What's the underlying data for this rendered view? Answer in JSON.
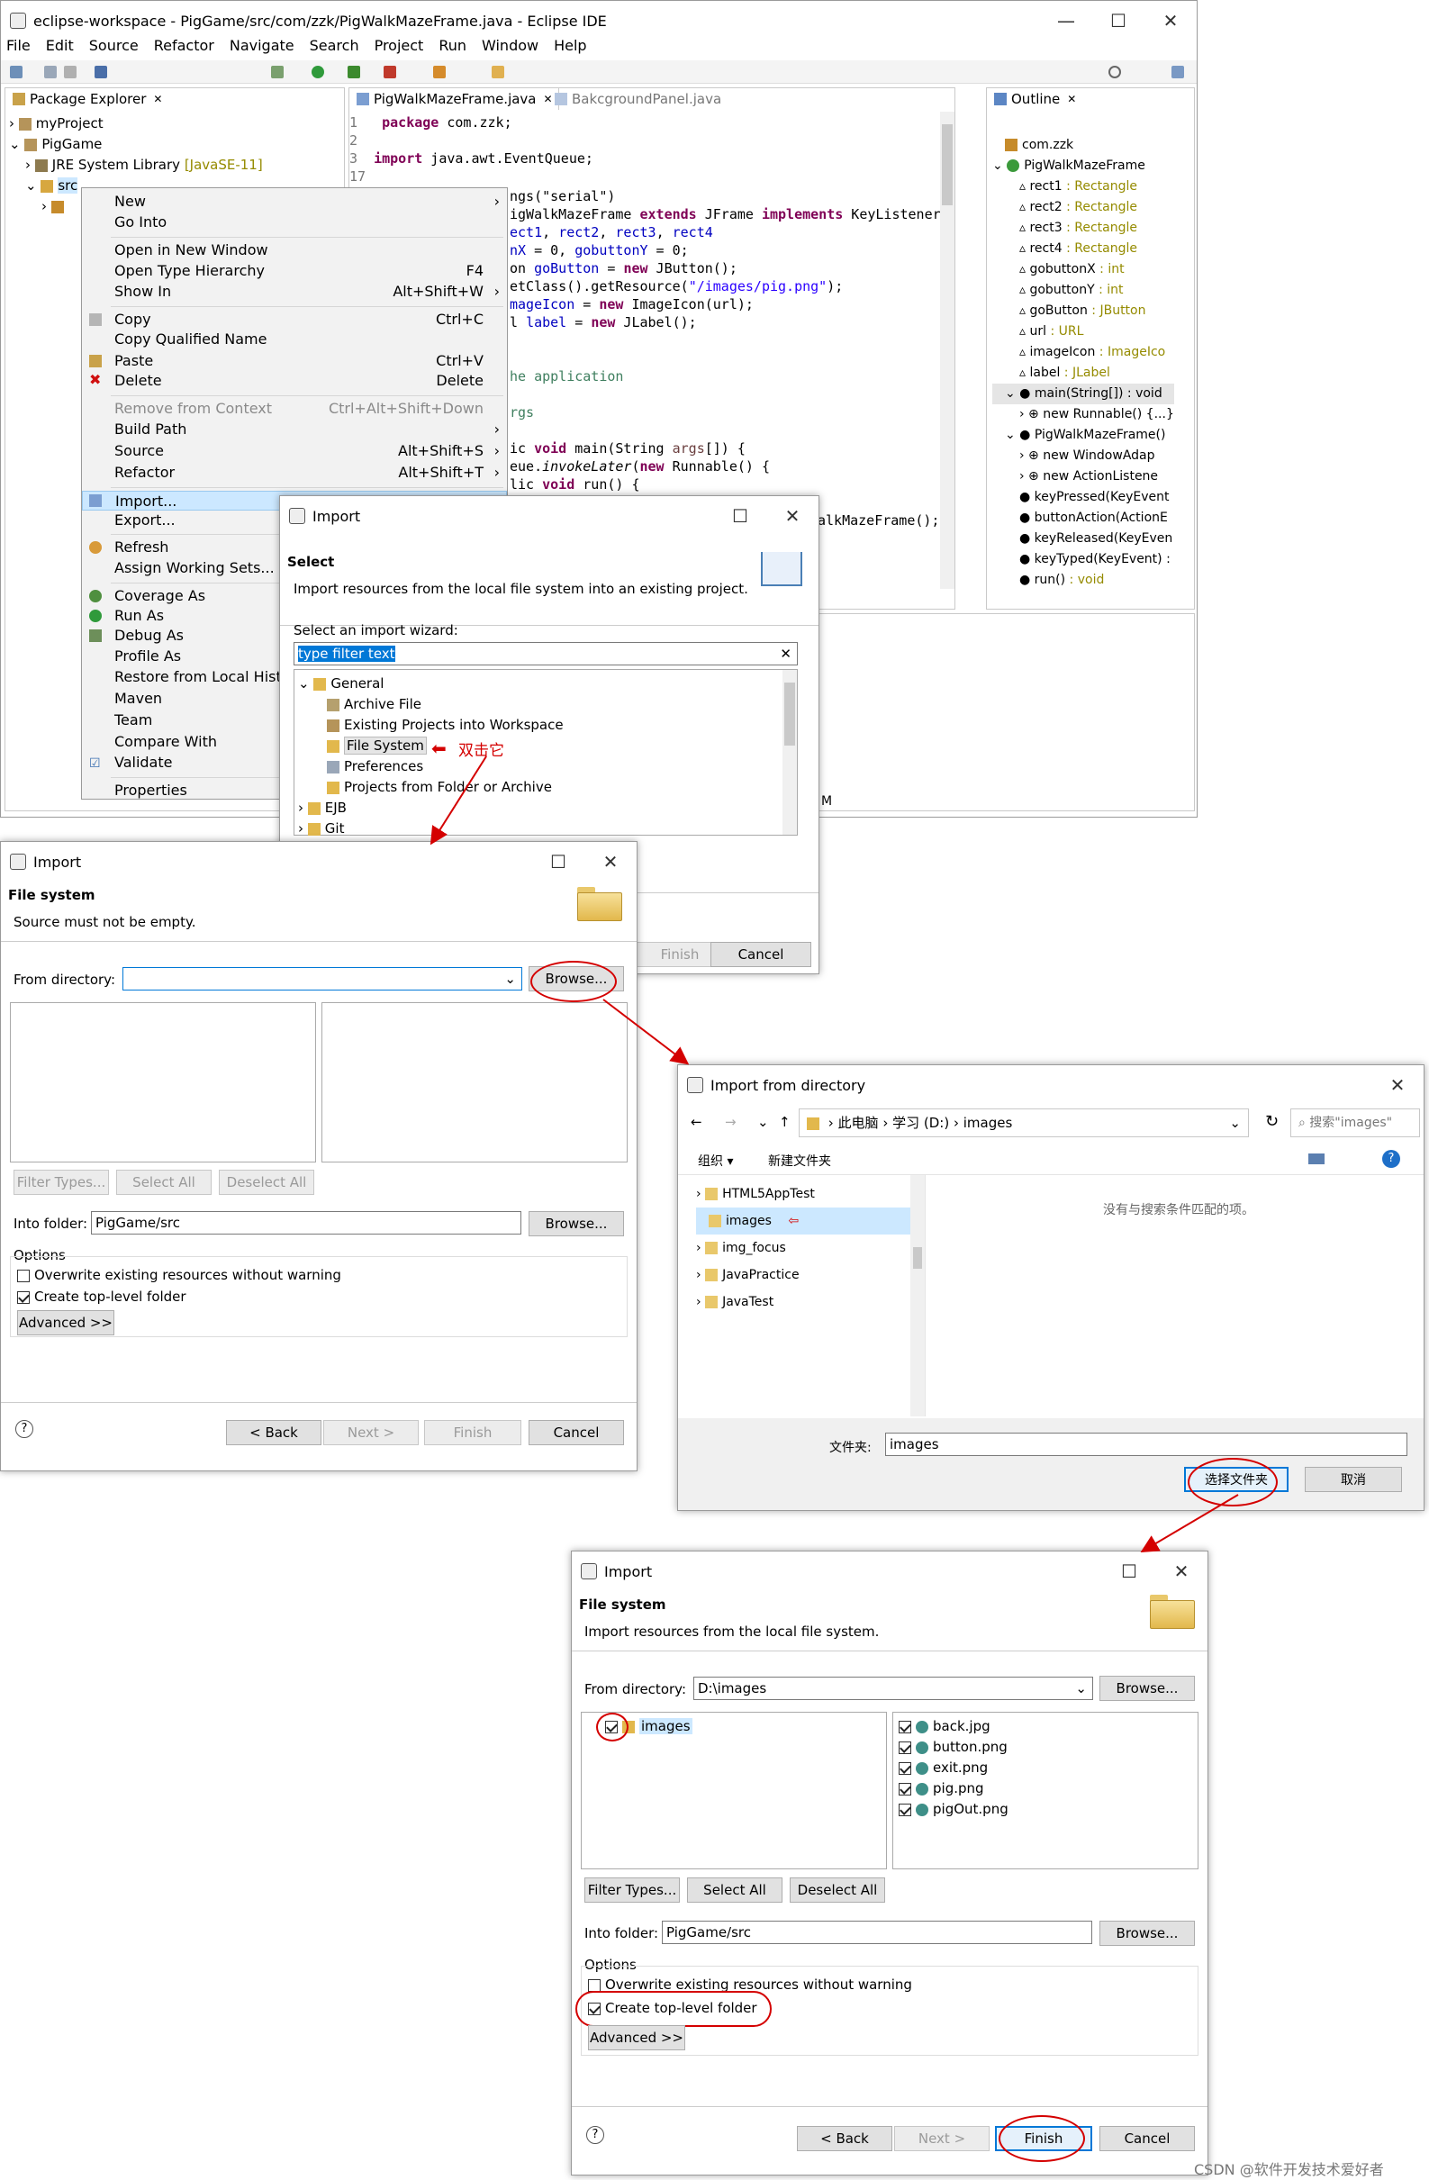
{
  "eclipse": {
    "title": "eclipse-workspace - PigGame/src/com/zzk/PigWalkMazeFrame.java - Eclipse IDE",
    "menus": [
      "File",
      "Edit",
      "Source",
      "Refactor",
      "Navigate",
      "Search",
      "Project",
      "Run",
      "Window",
      "Help"
    ],
    "pkg_tab": "Package Explorer",
    "pkg_items": [
      "myProject",
      "PigGame",
      "JRE System Library",
      "[JavaSE-11]",
      "src"
    ],
    "editor_tabs": [
      "PigWalkMazeFrame.java",
      "BakcgroundPanel.java"
    ],
    "outline_tab": "Outline",
    "outline_items": [
      {
        "n": "com.zzk",
        "t": ""
      },
      {
        "n": "PigWalkMazeFrame",
        "t": ""
      },
      {
        "n": "rect1",
        "t": " : Rectangle"
      },
      {
        "n": "rect2",
        "t": " : Rectangle"
      },
      {
        "n": "rect3",
        "t": " : Rectangle"
      },
      {
        "n": "rect4",
        "t": " : Rectangle"
      },
      {
        "n": "gobuttonX",
        "t": " : int"
      },
      {
        "n": "gobuttonY",
        "t": " : int"
      },
      {
        "n": "goButton",
        "t": " : JButton"
      },
      {
        "n": "url",
        "t": " : URL"
      },
      {
        "n": "imageIcon",
        "t": " : ImageIco"
      },
      {
        "n": "label",
        "t": " : JLabel"
      },
      {
        "n": "main(String[])",
        "t": " : void"
      },
      {
        "n": "new Runnable() {...}",
        "t": ""
      },
      {
        "n": "PigWalkMazeFrame()",
        "t": ""
      },
      {
        "n": "new WindowAdap",
        "t": ""
      },
      {
        "n": "new ActionListene",
        "t": ""
      },
      {
        "n": "keyPressed(KeyEvent",
        "t": ""
      },
      {
        "n": "buttonAction(ActionE",
        "t": ""
      },
      {
        "n": "keyReleased(KeyEven",
        "t": ""
      },
      {
        "n": "keyTyped(KeyEvent) :",
        "t": ""
      },
      {
        "n": "run()",
        "t": " : void"
      }
    ],
    "status_text": "M"
  },
  "code": {
    "l1n": "1",
    "l1a": "package",
    "l1b": " com.zzk;",
    "l2n": "2",
    "l3n": "3",
    "l3a": "import",
    "l3b": " java.awt.EventQueue;",
    "l17n": "17",
    "c1": "ngs(\"serial\")",
    "c2a": "igWalkMazeFrame ",
    "c2b": "extends",
    "c2c": " JFrame ",
    "c2d": "implements",
    "c2e": " KeyListener,",
    "c3a": "ect1",
    "c3b": ", ",
    "c3c": "rect2",
    "c3d": ", ",
    "c3e": "rect3",
    "c3f": ", ",
    "c3g": "rect4",
    "c4a": "nX",
    "c4b": " = 0, ",
    "c4c": "gobuttonY",
    "c4d": " = 0;",
    "c5a": "on ",
    "c5b": "goButton",
    "c5c": " = ",
    "c5d": "new",
    "c5e": " JButton();",
    "c6a": "etClass().getResource(",
    "c6b": "\"/images/pig.png\"",
    "c6c": ");",
    "c7a": "mageIcon",
    "c7b": " = ",
    "c7c": "new",
    "c7d": " ImageIcon(url);",
    "c8a": "l ",
    "c8b": "label",
    "c8c": " = ",
    "c8d": "new",
    "c8e": " JLabel();",
    "c9": "he application",
    "c10": "rgs",
    "c11a": "ic ",
    "c11b": "void",
    "c11c": " main(String ",
    "c11d": "args",
    "c11e": "[]) {",
    "c12a": "eue.",
    "c12b": "invokeLater",
    "c12c": "(",
    "c12d": "new",
    "c12e": " Runnable() {",
    "c13a": "lic ",
    "c13b": "void",
    "c13c": " run() {",
    "c14": "alkMazeFrame();"
  },
  "ctx": {
    "items": [
      {
        "label": "New",
        "sc": "",
        "ar": "›",
        "dis": false
      },
      {
        "label": "Go Into",
        "sc": "",
        "ar": "",
        "dis": false
      },
      {
        "label": "Open in New Window",
        "sc": "",
        "ar": "",
        "dis": false
      },
      {
        "label": "Open Type Hierarchy",
        "sc": "F4",
        "ar": "",
        "dis": false
      },
      {
        "label": "Show In",
        "sc": "Alt+Shift+W",
        "ar": "›",
        "dis": false
      },
      {
        "label": "Copy",
        "sc": "Ctrl+C",
        "ar": "",
        "dis": false
      },
      {
        "label": "Copy Qualified Name",
        "sc": "",
        "ar": "",
        "dis": false
      },
      {
        "label": "Paste",
        "sc": "Ctrl+V",
        "ar": "",
        "dis": false
      },
      {
        "label": "Delete",
        "sc": "Delete",
        "ar": "",
        "dis": false
      },
      {
        "label": "Remove from Context",
        "sc": "Ctrl+Alt+Shift+Down",
        "ar": "",
        "dis": true
      },
      {
        "label": "Build Path",
        "sc": "",
        "ar": "›",
        "dis": false
      },
      {
        "label": "Source",
        "sc": "Alt+Shift+S",
        "ar": "›",
        "dis": false
      },
      {
        "label": "Refactor",
        "sc": "Alt+Shift+T",
        "ar": "›",
        "dis": false
      },
      {
        "label": "Import...",
        "sc": "",
        "ar": "",
        "dis": false
      },
      {
        "label": "Export...",
        "sc": "",
        "ar": "",
        "dis": false
      },
      {
        "label": "Refresh",
        "sc": "",
        "ar": "",
        "dis": false
      },
      {
        "label": "Assign Working Sets...",
        "sc": "",
        "ar": "",
        "dis": false
      },
      {
        "label": "Coverage As",
        "sc": "",
        "ar": "",
        "dis": false
      },
      {
        "label": "Run As",
        "sc": "",
        "ar": "",
        "dis": false
      },
      {
        "label": "Debug As",
        "sc": "",
        "ar": "",
        "dis": false
      },
      {
        "label": "Profile As",
        "sc": "",
        "ar": "",
        "dis": false
      },
      {
        "label": "Restore from Local Histo",
        "sc": "",
        "ar": "",
        "dis": false
      },
      {
        "label": "Maven",
        "sc": "",
        "ar": "",
        "dis": false
      },
      {
        "label": "Team",
        "sc": "",
        "ar": "",
        "dis": false
      },
      {
        "label": "Compare With",
        "sc": "",
        "ar": "",
        "dis": false
      },
      {
        "label": "Validate",
        "sc": "",
        "ar": "",
        "dis": false
      },
      {
        "label": "Properties",
        "sc": "",
        "ar": "",
        "dis": false
      }
    ]
  },
  "import_select": {
    "title": "Import",
    "heading": "Select",
    "desc": "Import resources from the local file system into an existing project.",
    "wizard_label": "Select an import wizard:",
    "filter": "type filter text",
    "tree": [
      "General",
      "Archive File",
      "Existing Projects into Workspace",
      "File System",
      "Preferences",
      "Projects from Folder or Archive",
      "EJB",
      "Git"
    ],
    "annotation": "双击它",
    "finish": "Finish",
    "cancel": "Cancel"
  },
  "fs1": {
    "title": "Import",
    "heading": "File system",
    "desc": "Source must not be empty.",
    "from_label": "From directory:",
    "from_value": "",
    "browse": "Browse...",
    "filter_types": "Filter Types...",
    "select_all": "Select All",
    "deselect_all": "Deselect All",
    "into_label": "Into folder:",
    "into_value": "PigGame/src",
    "options": "Options",
    "overwrite": "Overwrite existing resources without warning",
    "create_top": "Create top-level folder",
    "advanced": "Advanced >>",
    "back": "< Back",
    "next": "Next >",
    "finish": "Finish",
    "cancel": "Cancel",
    "help": "?"
  },
  "dir": {
    "title": "Import from directory",
    "crumbs": [
      "此电脑",
      "学习 (D:)",
      "images"
    ],
    "search": "搜索\"images\"",
    "organize": "组织 ▾",
    "newfolder": "新建文件夹",
    "folders": [
      "HTML5AppTest",
      "images",
      "img_focus",
      "JavaPractice",
      "JavaTest"
    ],
    "empty": "没有与搜索条件匹配的项。",
    "folder_label": "文件夹:",
    "folder_value": "images",
    "select": "选择文件夹",
    "cancel": "取消"
  },
  "fs2": {
    "title": "Import",
    "heading": "File system",
    "desc": "Import resources from the local file system.",
    "from_label": "From directory:",
    "from_value": "D:\\images",
    "browse": "Browse...",
    "left_item": "images",
    "files": [
      "back.jpg",
      "button.png",
      "exit.png",
      "pig.png",
      "pigOut.png"
    ],
    "filter_types": "Filter Types...",
    "select_all": "Select All",
    "deselect_all": "Deselect All",
    "into_label": "Into folder:",
    "into_value": "PigGame/src",
    "options": "Options",
    "overwrite": "Overwrite existing resources without warning",
    "create_top": "Create top-level folder",
    "advanced": "Advanced >>",
    "back": "< Back",
    "next": "Next >",
    "finish": "Finish",
    "cancel": "Cancel",
    "help": "?"
  },
  "watermark": "CSDN @软件开发技术爱好者",
  "colors": {
    "accent": "#0078d7",
    "annotation": "#d40000",
    "select_bg": "#cce8ff",
    "type_color": "#958b00"
  }
}
